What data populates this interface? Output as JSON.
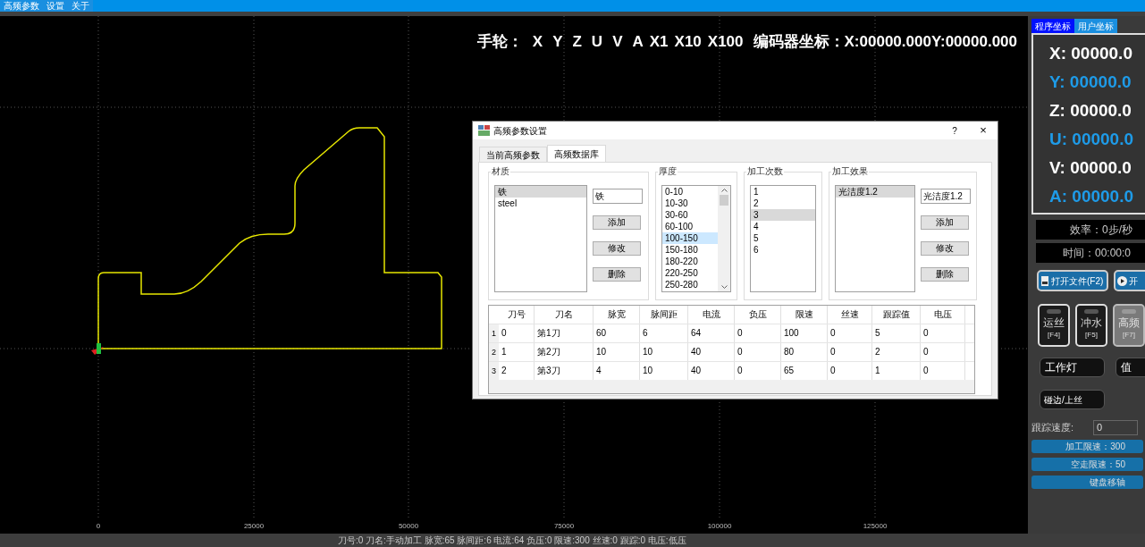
{
  "menu": [
    "高频参数",
    "设置",
    "关于"
  ],
  "handwheel": {
    "label": "手轮：",
    "axes": [
      "X",
      "Y",
      "Z",
      "U",
      "V",
      "A"
    ],
    "steps": [
      "X1",
      "X10",
      "X100"
    ],
    "encoder_label": "编码器坐标：",
    "encoder_x": "X:00000.000",
    "encoder_y": "Y:00000.000"
  },
  "x_axis_labels": [
    "0",
    "25000",
    "50000",
    "75000",
    "100000",
    "125000"
  ],
  "dialog": {
    "title": "高频参数设置",
    "help": "?",
    "close": "×",
    "tabs": [
      {
        "label": "当前高频参数",
        "selected": false
      },
      {
        "label": "高频数据库",
        "selected": true
      }
    ],
    "groups": [
      {
        "title": "材质",
        "items": [
          {
            "label": "铁",
            "selected": true
          },
          {
            "label": "steel",
            "selected": false
          }
        ],
        "input": "铁",
        "buttons": [
          "添加",
          "修改",
          "删除"
        ]
      },
      {
        "title": "厚度",
        "scrollbar": true,
        "items": [
          {
            "label": "0-10",
            "selected": false
          },
          {
            "label": "10-30",
            "selected": false
          },
          {
            "label": "30-60",
            "selected": false
          },
          {
            "label": "60-100",
            "selected": false
          },
          {
            "label": "100-150",
            "selected": true
          },
          {
            "label": "150-180",
            "selected": false
          },
          {
            "label": "180-220",
            "selected": false
          },
          {
            "label": "220-250",
            "selected": false
          },
          {
            "label": "250-280",
            "selected": false
          }
        ]
      },
      {
        "title": "加工次数",
        "items": [
          {
            "label": "1",
            "selected": false
          },
          {
            "label": "2",
            "selected": false
          },
          {
            "label": "3",
            "selected": true
          },
          {
            "label": "4",
            "selected": false
          },
          {
            "label": "5",
            "selected": false
          },
          {
            "label": "6",
            "selected": false
          }
        ]
      },
      {
        "title": "加工效果",
        "items": [
          {
            "label": "光洁度1.2",
            "selected": true
          }
        ],
        "input": "光洁度1.2",
        "buttons": [
          "添加",
          "修改",
          "删除"
        ]
      }
    ],
    "table": {
      "columns": [
        "刀号",
        "刀名",
        "脉宽",
        "脉间距",
        "电流",
        "负压",
        "限速",
        "丝速",
        "跟踪值",
        "电压"
      ],
      "rows": [
        {
          "index": "1",
          "cells": [
            "0",
            "第1刀",
            "60",
            "6",
            "64",
            "0",
            "100",
            "0",
            "5",
            "0"
          ]
        },
        {
          "index": "2",
          "cells": [
            "1",
            "第2刀",
            "10",
            "10",
            "40",
            "0",
            "80",
            "0",
            "2",
            "0"
          ]
        },
        {
          "index": "3",
          "cells": [
            "2",
            "第3刀",
            "4",
            "10",
            "40",
            "0",
            "65",
            "0",
            "1",
            "0"
          ]
        }
      ]
    }
  },
  "side": {
    "tabs": [
      {
        "label": "程序坐标",
        "selected": true
      },
      {
        "label": "用户坐标",
        "selected": false
      }
    ],
    "coords": [
      {
        "text": "X: 00000.0",
        "color": "#ffffff"
      },
      {
        "text": "Y: 00000.0",
        "color": "#1e9be8"
      },
      {
        "text": "Z: 00000.0",
        "color": "#ffffff"
      },
      {
        "text": "U: 00000.0",
        "color": "#1e9be8"
      },
      {
        "text": "V: 00000.0",
        "color": "#ffffff"
      },
      {
        "text": "A: 00000.0",
        "color": "#1e9be8"
      }
    ],
    "efficiency": "效率：0步/秒",
    "time": "时间：00:00:0",
    "file_buttons": [
      {
        "label": "打开文件(F2)",
        "kind": "file"
      },
      {
        "label": "开",
        "kind": "play"
      }
    ],
    "toggles": [
      {
        "label": "运丝",
        "key": "[F4]",
        "on": false
      },
      {
        "label": "冲水",
        "key": "[F5]",
        "on": false
      },
      {
        "label": "高频",
        "key": "[F7]",
        "on": true
      }
    ],
    "switches": [
      "工作灯",
      "值",
      "碰边/上丝"
    ],
    "track_label": "跟踪速度:",
    "track_value": "0",
    "bars": [
      "加工限速：300",
      "空走限速：50",
      "键盘移轴"
    ]
  },
  "status_bar": "刀号:0 刀名:手动加工 脉宽:65 脉间距:6 电流:64 负压:0 限速:300 丝速:0 跟踪:0 电压:低压"
}
